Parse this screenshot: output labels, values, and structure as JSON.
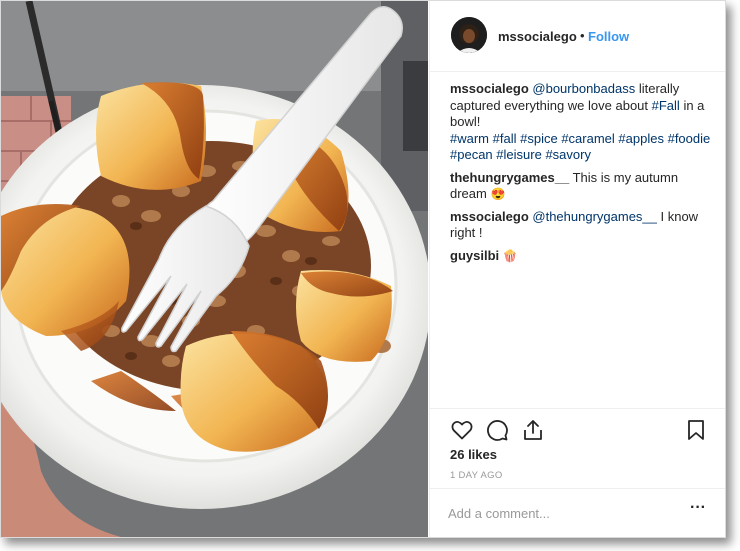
{
  "post": {
    "image_alt": "Bowl of caramel apples with pecans",
    "author": "mssocialego",
    "separator": "•",
    "follow_label": "Follow"
  },
  "comments": [
    {
      "user": "mssocialego",
      "parts": [
        {
          "text": "@bourbonbadass",
          "link": true
        },
        {
          "text": " literally captured everything we love about ",
          "link": false
        },
        {
          "text": "#Fall",
          "link": true
        },
        {
          "text": " in a bowl!",
          "link": false
        }
      ],
      "hashtags": [
        "#warm",
        "#fall",
        "#spice",
        "#caramel",
        "#apples",
        "#foodie",
        "#pecan",
        "#leisure",
        "#savory"
      ]
    },
    {
      "user": "thehungrygames__",
      "parts": [
        {
          "text": "This is my autumn dream ",
          "link": false
        },
        {
          "text": "😍",
          "link": false
        }
      ]
    },
    {
      "user": "mssocialego",
      "parts": [
        {
          "text": "@thehungrygames__",
          "link": true
        },
        {
          "text": " I know right !",
          "link": false
        }
      ]
    },
    {
      "user": "guysilbi",
      "parts": [
        {
          "text": "🍿",
          "link": false
        }
      ]
    }
  ],
  "actions": {
    "like_icon": "heart-icon",
    "comment_icon": "comment-icon",
    "share_icon": "share-icon",
    "save_icon": "bookmark-icon"
  },
  "likes": "26 likes",
  "timestamp": "1 DAY AGO",
  "add_comment": {
    "placeholder": "Add a comment...",
    "more_label": "···"
  },
  "colors": {
    "link": "#003569",
    "follow": "#3897f0",
    "text": "#262626",
    "muted": "#999999",
    "caramel": "#b5561a",
    "apple": "#f4c86a"
  }
}
